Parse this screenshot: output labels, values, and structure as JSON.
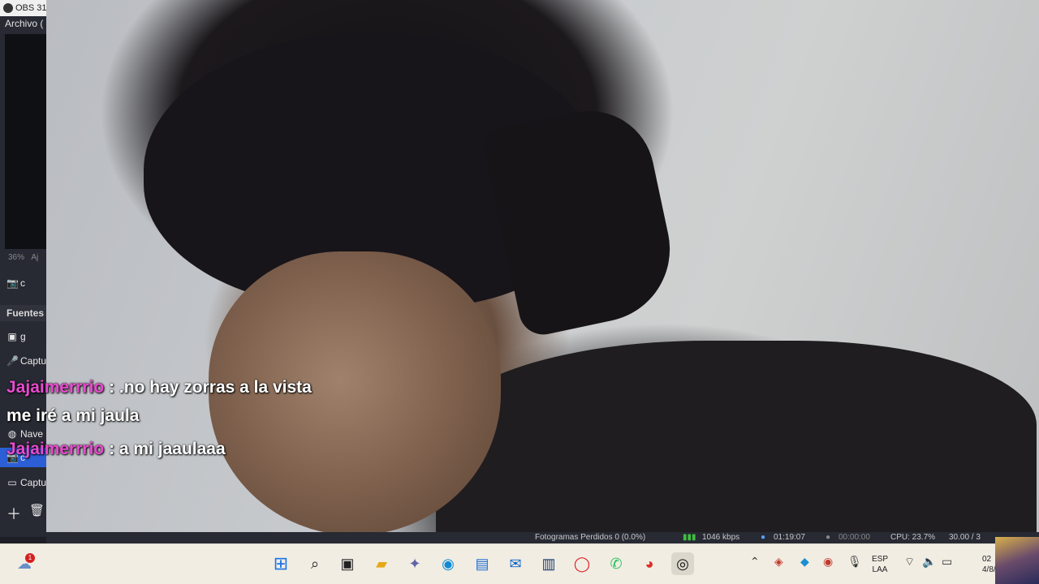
{
  "obs": {
    "title": "OBS 31",
    "menu_archivo": "Archivo (",
    "zoom": "36%",
    "zoom_fit": "Aj",
    "scene_item": "c",
    "fuentes_label": "Fuentes",
    "sources": [
      {
        "icon": "image-icon",
        "label": "g"
      },
      {
        "icon": "mic-icon",
        "label": "Captu"
      },
      {
        "icon": "browser-icon",
        "label": "Nave"
      },
      {
        "icon": "camera-icon",
        "label": "c"
      },
      {
        "icon": "monitor-icon",
        "label": "Captu"
      }
    ]
  },
  "chat": [
    {
      "user": "Jajaimerrrio",
      "sep": " : ",
      "msg": ".no hay zorras a la vista"
    },
    {
      "user": "",
      "sep": "",
      "msg": "me iré a mi jaula"
    },
    {
      "user": "Jajaimerrrio",
      "sep": " : ",
      "msg": "a mi jaaulaaa"
    }
  ],
  "status": {
    "dropped": "Fotogramas Perdidos 0 (0.0%)",
    "bitrate": "1046 kbps",
    "live_time": "01:19:07",
    "rec_time": "00:00:00",
    "cpu": "CPU: 23.7%",
    "fps": "30.00 / 3"
  },
  "taskbar": {
    "notif_count": "1",
    "lang_line1": "ESP",
    "lang_line2": "LAA",
    "time": "02",
    "date": "4/8/20"
  }
}
